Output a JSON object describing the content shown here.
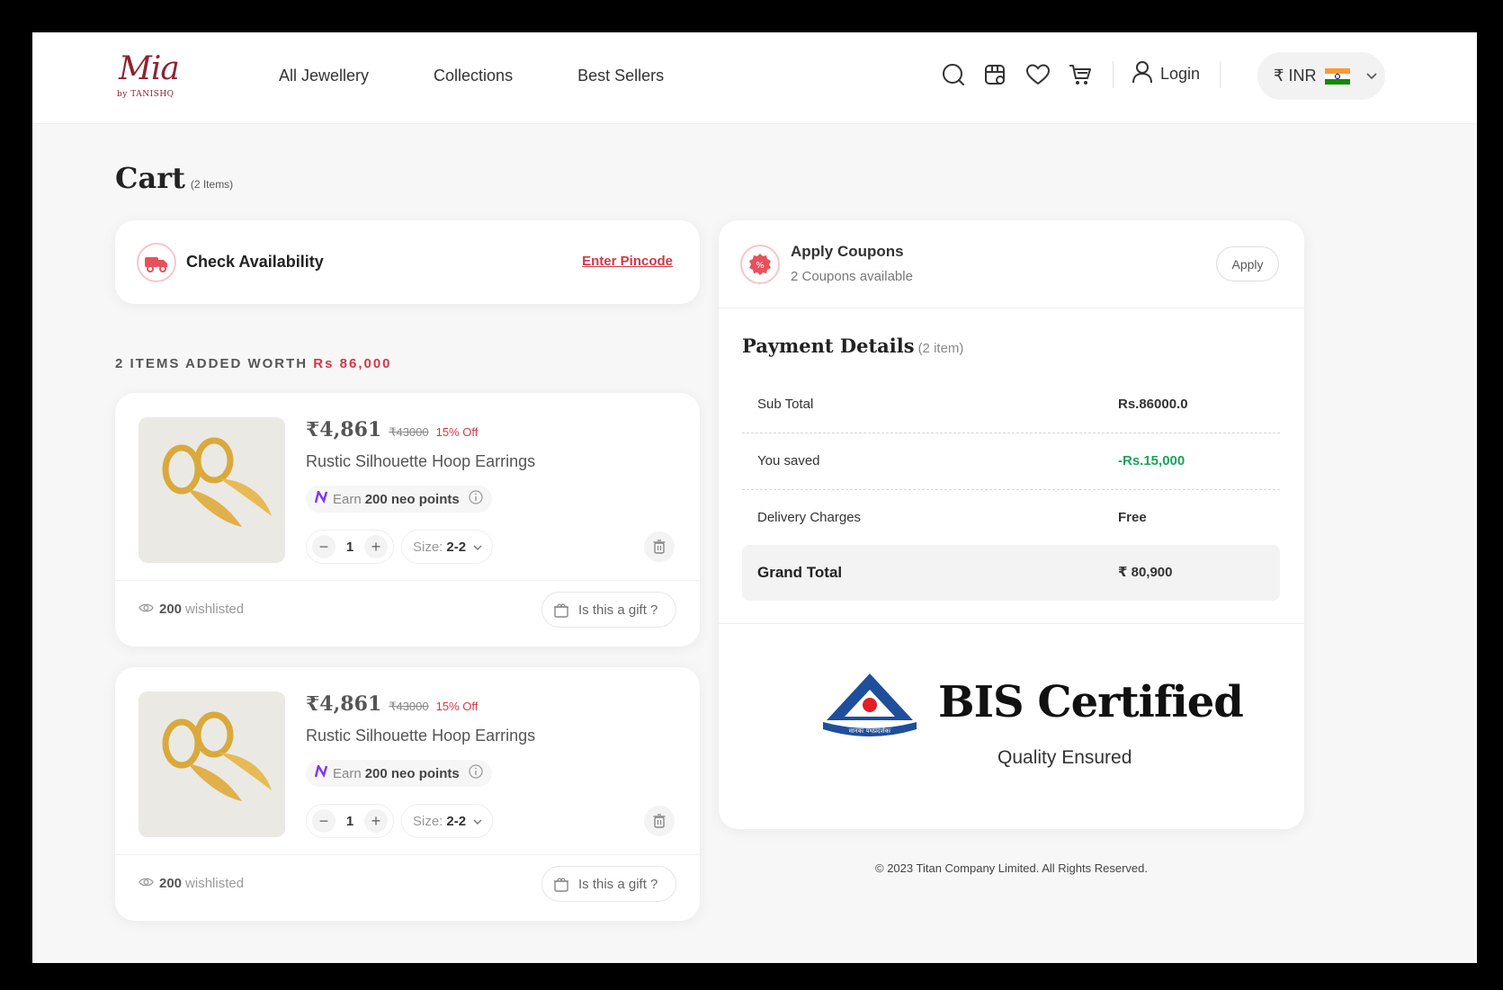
{
  "brand": {
    "logo_main": "Mia",
    "logo_sub": "by TANISHQ"
  },
  "nav": {
    "items": [
      "All Jewellery",
      "Collections",
      "Best Sellers"
    ]
  },
  "header": {
    "icons": [
      "search-icon",
      "store-icon",
      "heart-icon",
      "cart-icon",
      "user-icon"
    ],
    "login_label": "Login",
    "currency_label": "₹ INR",
    "flag_colors": [
      "#ff9933",
      "#ffffff",
      "#138808"
    ]
  },
  "cart": {
    "title": "Cart",
    "count": "(2 Items)"
  },
  "availability": {
    "label": "Check Availability",
    "link": "Enter Pincode"
  },
  "summary": {
    "prefix": "2 ITEMS ADDED WORTH",
    "amount": "Rs 86,000"
  },
  "items": [
    {
      "price": "₹4,861",
      "mrp": "₹43000",
      "discount": "15% Off",
      "name": "Rustic Silhouette Hoop Earrings",
      "neo_prefix": "Earn",
      "neo_value": "200 neo points",
      "qty": "1",
      "size_label": "Size:",
      "size_value": "2-2",
      "wishlisted_count": "200",
      "wishlisted_label": "wishlisted",
      "gift_label": "Is this a gift ?"
    },
    {
      "price": "₹4,861",
      "mrp": "₹43000",
      "discount": "15% Off",
      "name": "Rustic Silhouette Hoop Earrings",
      "neo_prefix": "Earn",
      "neo_value": "200 neo points",
      "qty": "1",
      "size_label": "Size:",
      "size_value": "2-2",
      "wishlisted_count": "200",
      "wishlisted_label": "wishlisted",
      "gift_label": "Is this a gift ?"
    }
  ],
  "coupons": {
    "title": "Apply Coupons",
    "subtitle": "2 Coupons available",
    "apply_label": "Apply"
  },
  "payment": {
    "title": "Payment Details",
    "count": "(2 item)",
    "rows": [
      {
        "label": "Sub Total",
        "value": "Rs.86000.0"
      },
      {
        "label": "You saved",
        "value": "-Rs.15,000"
      },
      {
        "label": "Delivery Charges",
        "value": "Free"
      }
    ],
    "grand_label": "Grand Total",
    "grand_value": "₹ 80,900"
  },
  "bis": {
    "title": "BIS Certified",
    "subtitle": "Quality Ensured",
    "logo_text": "मानकः पथप्रदर्शकः"
  },
  "footer": {
    "text": "© 2023 Titan Company Limited. All Rights Reserved."
  },
  "colors": {
    "accent": "#d0384a",
    "brand": "#8d2332",
    "saved": "#1aa35b",
    "bis_blue": "#1f4e9a",
    "bis_red": "#e31e24"
  }
}
